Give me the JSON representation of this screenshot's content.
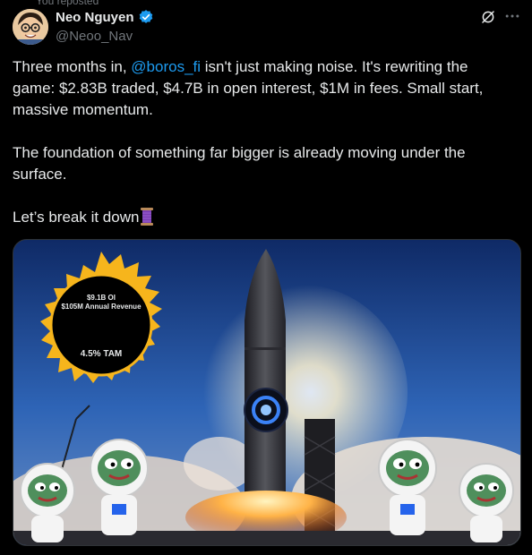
{
  "repost_label": "You reposted",
  "author": {
    "name": "Neo Nguyen",
    "handle": "@Neoo_Nav"
  },
  "tweet": {
    "p1_pre": "Three months in, ",
    "mention": "@boros_fi",
    "p1_post": " isn't just making noise.  It's rewriting the game: $2.83B traded, $4.7B in open interest, $1M in fees. Small start, massive momentum.",
    "p2": "The foundation of something far bigger is already moving under the surface.",
    "p3": "Let’s break it down"
  },
  "media": {
    "sun_line1": "$9.1B OI",
    "sun_line2": "$105M Annual Revenue",
    "sun_tam": "4.5% TAM"
  },
  "colors": {
    "link": "#1d9bf0",
    "verified": "#1d9bf0",
    "muted": "#71767b"
  },
  "icons": [
    "grok-icon",
    "more-icon",
    "verified-badge-icon",
    "spool-emoji"
  ]
}
